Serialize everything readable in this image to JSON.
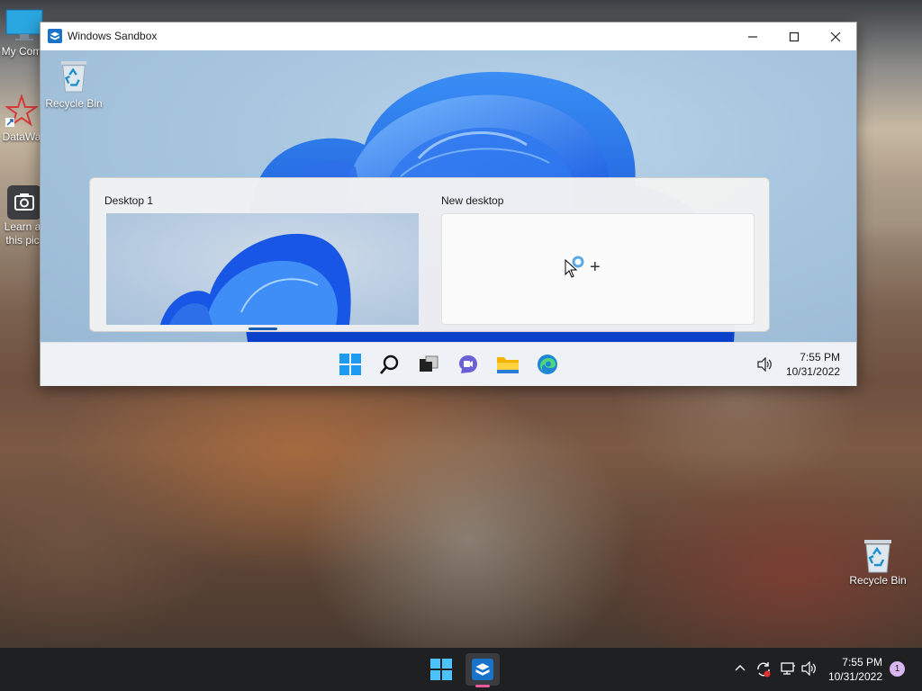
{
  "window": {
    "title": "Windows Sandbox"
  },
  "sandbox_desktop": {
    "recycle_bin_label": "Recycle Bin"
  },
  "task_view": {
    "desktops": [
      {
        "label": "Desktop 1"
      },
      {
        "label": "New desktop"
      }
    ],
    "add_symbol": "+"
  },
  "vm_taskbar": {
    "time": "7:55 PM",
    "date": "10/31/2022",
    "apps": [
      "start-icon",
      "search-icon",
      "task-view-icon",
      "chat-icon",
      "file-explorer-icon",
      "edge-icon"
    ]
  },
  "host_desktop": {
    "icons": [
      {
        "label": "My Com"
      },
      {
        "label": "DataWa"
      },
      {
        "label": "Learn a this pic"
      },
      {
        "label": "Recycle Bin"
      }
    ]
  },
  "host_taskbar": {
    "time": "7:55 PM",
    "date": "10/31/2022",
    "notification_count": "1",
    "accent_color": "#e85aa0"
  }
}
